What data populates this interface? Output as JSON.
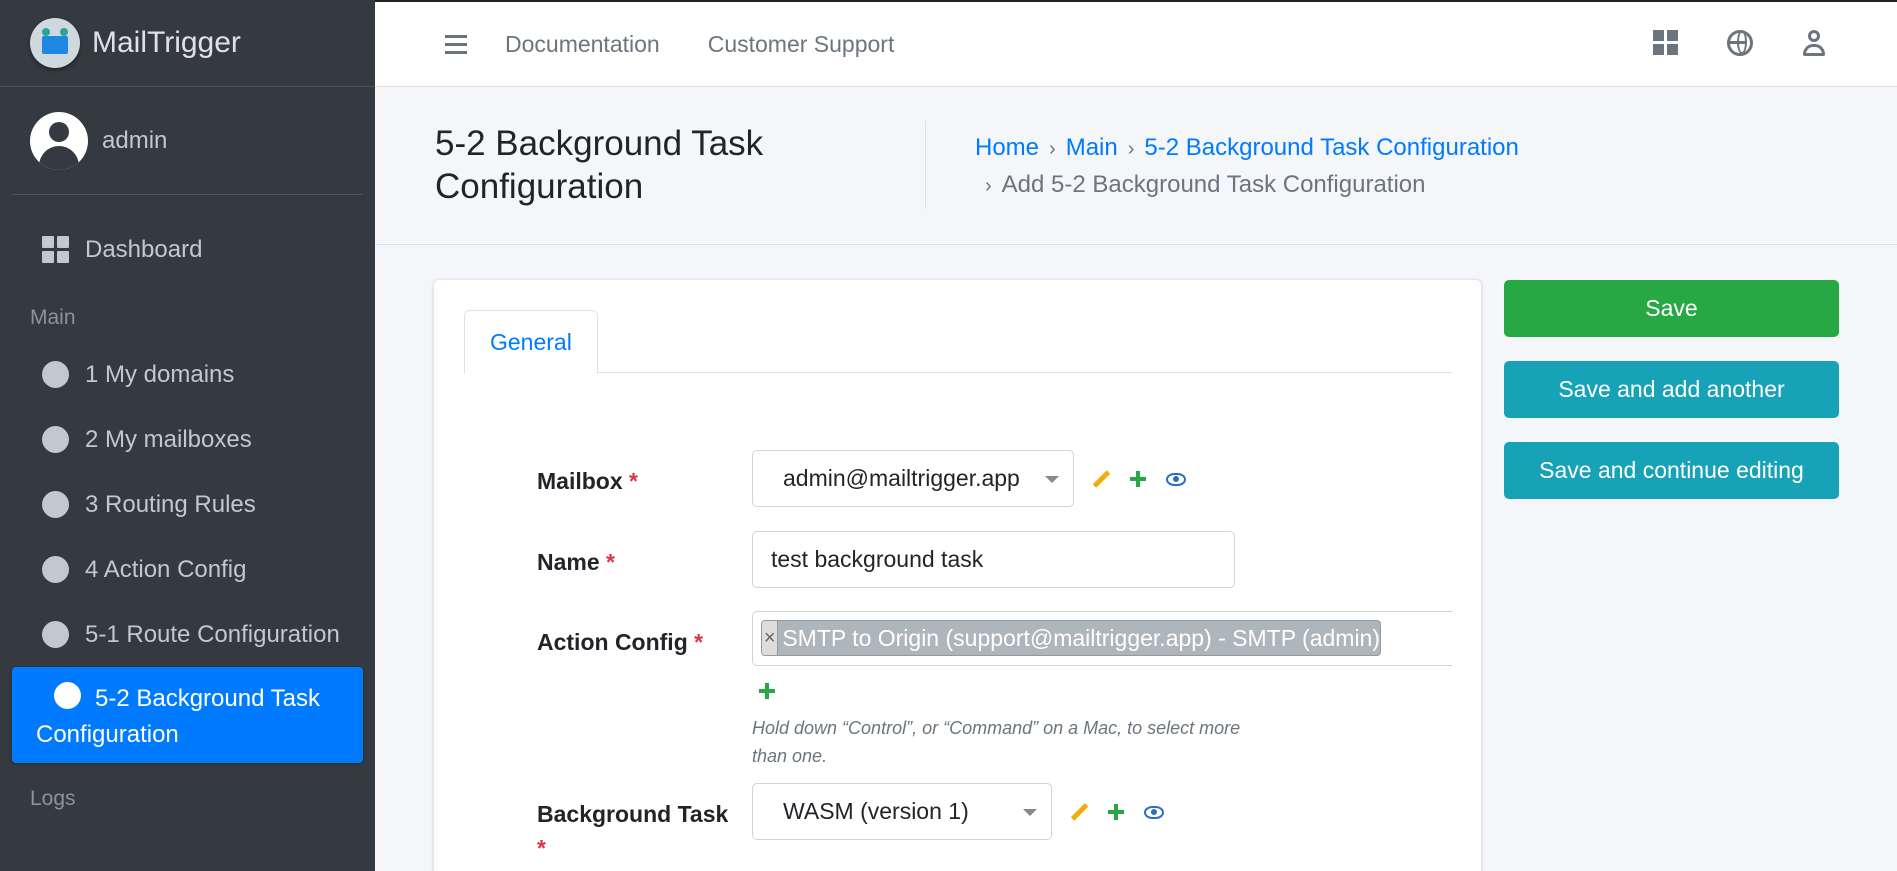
{
  "brand": {
    "name": "MailTrigger"
  },
  "user": {
    "name": "admin"
  },
  "sidebar": {
    "dashboard": "Dashboard",
    "main_header": "Main",
    "items": [
      {
        "label": "1 My domains"
      },
      {
        "label": "2 My mailboxes"
      },
      {
        "label": "3 Routing Rules"
      },
      {
        "label": "4 Action Config"
      },
      {
        "label": "5-1 Route Configuration"
      }
    ],
    "active_line1": "5-2 Background Task",
    "active_line2": "Configuration",
    "logs_header": "Logs"
  },
  "topbar": {
    "documentation": "Documentation",
    "support": "Customer Support"
  },
  "header": {
    "title": "5-2 Background Task Configuration",
    "breadcrumb": {
      "home": "Home",
      "main": "Main",
      "section": "5-2 Background Task Configuration",
      "current": "Add 5-2 Background Task Configuration"
    }
  },
  "form": {
    "tab": "General",
    "mailbox": {
      "label": "Mailbox",
      "value": "admin@mailtrigger.app"
    },
    "name": {
      "label": "Name",
      "value": "test background task"
    },
    "action_config": {
      "label": "Action Config",
      "chip": "SMTP to Origin (support@mailtrigger.app) - SMTP (admin)",
      "chip_remove": "×",
      "help": "Hold down “Control”, or “Command” on a Mac, to select more than one."
    },
    "background_task": {
      "label": "Background Task",
      "value": "WASM (version 1)"
    },
    "required_mark": "*"
  },
  "buttons": {
    "save": "Save",
    "save_add": "Save and add another",
    "save_continue": "Save and continue editing"
  },
  "colors": {
    "sidebar_bg": "#343a40",
    "primary": "#007bff",
    "success": "#28a745",
    "info": "#17a2b8",
    "danger": "#dc3545"
  }
}
